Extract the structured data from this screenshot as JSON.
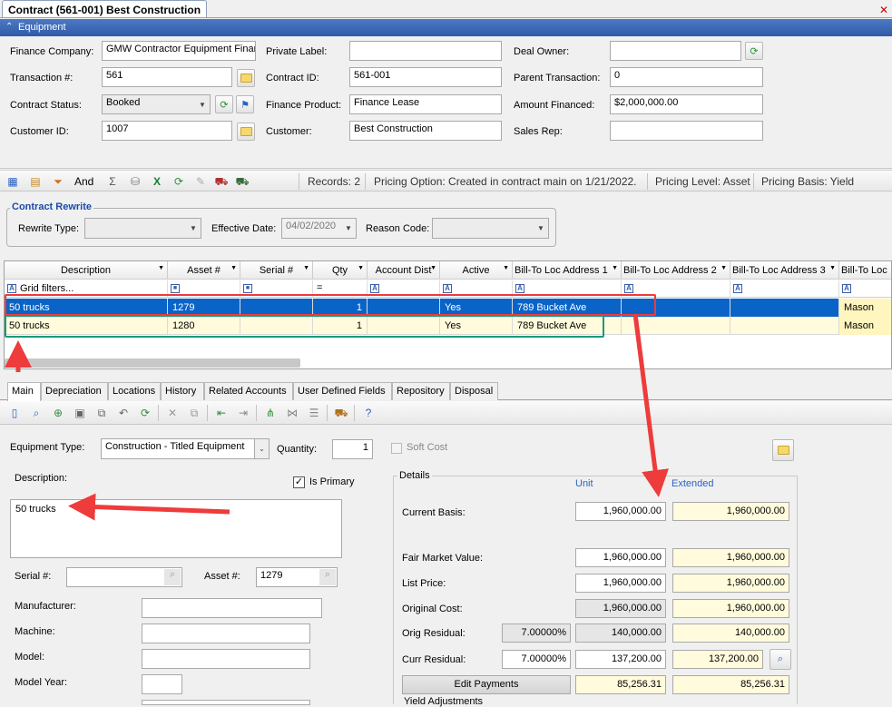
{
  "document_tab": "Contract (561-001) Best Construction",
  "section_title": "Equipment",
  "header": {
    "finance_company_label": "Finance Company:",
    "finance_company_value": "GMW Contractor Equipment Finan",
    "transaction_label": "Transaction #:",
    "transaction_value": "561",
    "contract_status_label": "Contract Status:",
    "contract_status_value": "Booked",
    "customer_id_label": "Customer ID:",
    "customer_id_value": "1007",
    "private_label_label": "Private Label:",
    "private_label_value": "",
    "contract_id_label": "Contract ID:",
    "contract_id_value": "561-001",
    "finance_product_label": "Finance Product:",
    "finance_product_value": "Finance Lease",
    "customer_label": "Customer:",
    "customer_value": "Best Construction",
    "deal_owner_label": "Deal Owner:",
    "deal_owner_value": "",
    "parent_transaction_label": "Parent Transaction:",
    "parent_transaction_value": "0",
    "amount_financed_label": "Amount Financed:",
    "amount_financed_value": "$2,000,000.00",
    "sales_rep_label": "Sales Rep:",
    "sales_rep_value": ""
  },
  "toolbar": {
    "and_label": "And",
    "records": "Records: 2",
    "pricing_option": "Pricing Option: Created in contract main on 1/21/2022.",
    "pricing_level": "Pricing Level: Asset",
    "pricing_basis": "Pricing Basis: Yield"
  },
  "rewrite": {
    "title": "Contract Rewrite",
    "rewrite_type_label": "Rewrite Type:",
    "rewrite_type_value": "",
    "effective_date_label": "Effective Date:",
    "effective_date_value": "04/02/2020",
    "reason_code_label": "Reason Code:",
    "reason_code_value": ""
  },
  "grid": {
    "columns": [
      "Description",
      "Asset #",
      "Serial #",
      "Qty",
      "Account Dist",
      "Active",
      "Bill-To Loc Address 1",
      "Bill-To Loc Address 2",
      "Bill-To Loc Address 3",
      "Bill-To Loc"
    ],
    "filter_placeholder": "Grid filters...",
    "rows": [
      {
        "description": "50 trucks",
        "asset": "1279",
        "serial": "",
        "qty": "1",
        "account_dist": "",
        "active": "Yes",
        "addr1": "789 Bucket Ave",
        "addr2": "",
        "addr3": "",
        "loc": "Mason"
      },
      {
        "description": "50 trucks",
        "asset": "1280",
        "serial": "",
        "qty": "1",
        "account_dist": "",
        "active": "Yes",
        "addr1": "789 Bucket Ave",
        "addr2": "",
        "addr3": "",
        "loc": "Mason"
      }
    ]
  },
  "detail_tabs": [
    "Main",
    "Depreciation",
    "Locations",
    "History",
    "Related Accounts",
    "User Defined Fields",
    "Repository",
    "Disposal"
  ],
  "main": {
    "equipment_type_label": "Equipment Type:",
    "equipment_type_value": "Construction - Titled Equipment",
    "quantity_label": "Quantity:",
    "quantity_value": "1",
    "soft_cost_label": "Soft Cost",
    "description_label": "Description:",
    "is_primary_label": "Is Primary",
    "description_value": "50 trucks",
    "serial_label": "Serial #:",
    "serial_value": "",
    "asset_label": "Asset #:",
    "asset_value": "1279",
    "manufacturer_label": "Manufacturer:",
    "machine_label": "Machine:",
    "model_label": "Model:",
    "model_year_label": "Model Year:"
  },
  "details": {
    "title": "Details",
    "unit_label": "Unit",
    "extended_label": "Extended",
    "current_basis_label": "Current Basis:",
    "current_basis_unit": "1,960,000.00",
    "current_basis_ext": "1,960,000.00",
    "fmv_label": "Fair Market Value:",
    "fmv_unit": "1,960,000.00",
    "fmv_ext": "1,960,000.00",
    "list_price_label": "List Price:",
    "list_price_unit": "1,960,000.00",
    "list_price_ext": "1,960,000.00",
    "orig_cost_label": "Original Cost:",
    "orig_cost_unit": "1,960,000.00",
    "orig_cost_ext": "1,960,000.00",
    "orig_residual_label": "Orig Residual:",
    "orig_residual_pct": "7.00000%",
    "orig_residual_unit": "140,000.00",
    "orig_residual_ext": "140,000.00",
    "curr_residual_label": "Curr Residual:",
    "curr_residual_pct": "7.00000%",
    "curr_residual_unit": "137,200.00",
    "curr_residual_ext": "137,200.00",
    "edit_payments_label": "Edit Payments",
    "payments_unit": "85,256.31",
    "payments_ext": "85,256.31",
    "yield_adjustments_label": "Yield Adjustments"
  },
  "colors": {
    "accent": "#2f5aa8",
    "selected_row": "#0a64c8",
    "highlight_red": "#ee3b3b",
    "highlight_green": "#1a9a7a"
  }
}
